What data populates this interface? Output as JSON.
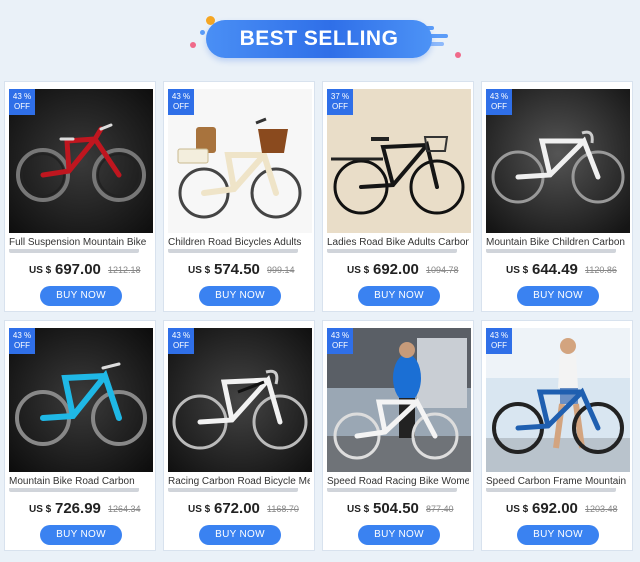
{
  "banner": {
    "title": "BEST SELLING"
  },
  "products": [
    {
      "discount_value": "43 %",
      "discount_label": "OFF",
      "title": "Full Suspension Mountain Bike",
      "currency": "US $",
      "price": "697.00",
      "old_price": "1212.18",
      "button": "BUY NOW",
      "image": "red-full-suspension-mountain-bike"
    },
    {
      "discount_value": "43 %",
      "discount_label": "OFF",
      "title": "Children Road Bicycles Adults",
      "currency": "US $",
      "price": "574.50",
      "old_price": "999.14",
      "button": "BUY NOW",
      "image": "cream-city-bike-with-child-seat"
    },
    {
      "discount_value": "37 %",
      "discount_label": "OFF",
      "title": "Ladies Road Bike Adults Carbon",
      "currency": "US $",
      "price": "692.00",
      "old_price": "1094.78",
      "button": "BUY NOW",
      "image": "black-classic-roadster-bike"
    },
    {
      "discount_value": "43 %",
      "discount_label": "OFF",
      "title": "Mountain Bike Children Carbon",
      "currency": "US $",
      "price": "644.49",
      "old_price": "1120.86",
      "button": "BUY NOW",
      "image": "white-road-bike"
    },
    {
      "discount_value": "43 %",
      "discount_label": "OFF",
      "title": "Mountain Bike Road Carbon",
      "currency": "US $",
      "price": "726.99",
      "old_price": "1264.34",
      "button": "BUY NOW",
      "image": "cyan-mountain-bike"
    },
    {
      "discount_value": "43 %",
      "discount_label": "OFF",
      "title": "Racing Carbon Road Bicycle Men",
      "currency": "US $",
      "price": "672.00",
      "old_price": "1168.70",
      "button": "BUY NOW",
      "image": "white-black-racing-bike"
    },
    {
      "discount_value": "43 %",
      "discount_label": "OFF",
      "title": "Speed Road Racing Bike Women",
      "currency": "US $",
      "price": "504.50",
      "old_price": "877.40",
      "button": "BUY NOW",
      "image": "man-with-white-road-bike"
    },
    {
      "discount_value": "43 %",
      "discount_label": "OFF",
      "title": "Speed Carbon Frame Mountain",
      "currency": "US $",
      "price": "692.00",
      "old_price": "1203.48",
      "button": "BUY NOW",
      "image": "woman-with-blue-road-bike"
    }
  ],
  "colors": {
    "accent": "#2f6fe8",
    "button": "#3a82f1",
    "background": "#eaf1f8"
  }
}
